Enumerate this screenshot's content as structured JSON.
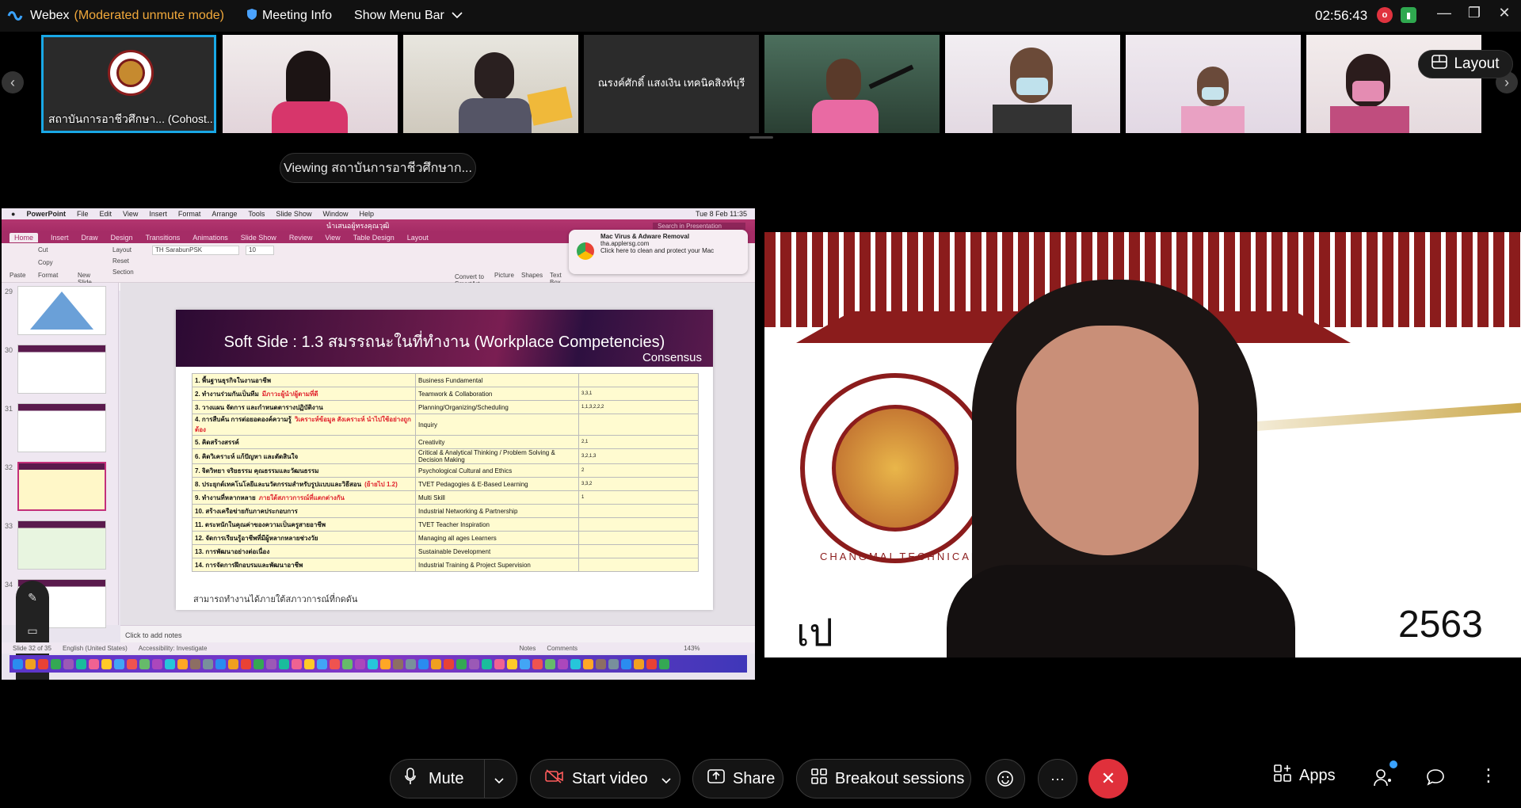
{
  "window": {
    "app_name": "Webex",
    "mode": "(Moderated unmute mode)",
    "meeting_info": "Meeting Info",
    "show_menu_bar": "Show Menu Bar",
    "clock": "02:56:43",
    "rec_icon": "record-icon",
    "minimize": "—",
    "restore": "❐",
    "close": "✕"
  },
  "participants": [
    {
      "name": "สถาบันการอาชีวศึกษา... (Cohost...)",
      "kind": "logo",
      "active": true
    },
    {
      "name": "",
      "kind": "video",
      "color": "#e7d9dc"
    },
    {
      "name": "",
      "kind": "video",
      "color": "#d8d4cc"
    },
    {
      "name": "ณรงค์ศักดิ์ แสงเงิน เทคนิคสิงห์บุรี",
      "kind": "text"
    },
    {
      "name": "",
      "kind": "video",
      "color": "#557a66"
    },
    {
      "name": "",
      "kind": "video",
      "color": "#e6dde5"
    },
    {
      "name": "",
      "kind": "video",
      "color": "#e4dcea"
    },
    {
      "name": "",
      "kind": "video",
      "color": "#eae1e4"
    }
  ],
  "layout_button": "Layout",
  "viewing_label": "Viewing สถาบันการอาชีวศึกษาก...",
  "shared_screen": {
    "mac_menu": [
      "PowerPoint",
      "File",
      "Edit",
      "View",
      "Insert",
      "Format",
      "Arrange",
      "Tools",
      "Slide Show",
      "Window",
      "Help"
    ],
    "mac_time": "Tue 8 Feb  11:35",
    "doc_title": "นำเสนอผู้ทรงคุณวุฒิ",
    "ribbon_tabs": [
      "Home",
      "Insert",
      "Draw",
      "Design",
      "Transitions",
      "Animations",
      "Slide Show",
      "Review",
      "View",
      "Table Design",
      "Layout"
    ],
    "font_name": "TH SarabunPSK",
    "font_size": "10",
    "ribbon_labels": {
      "paste": "Paste",
      "cut": "Cut",
      "copy": "Copy",
      "format": "Format",
      "new_slide": "New Slide",
      "layout": "Layout",
      "reset": "Reset",
      "section": "Section",
      "picture": "Picture",
      "shapes": "Shapes",
      "text_box": "Text Box",
      "convert": "Convert to SmartArt"
    },
    "popup": {
      "title": "Mac Virus & Adware Removal",
      "domain": "tha.applersg.com",
      "body": "Click here to clean and protect your Mac"
    },
    "search_placeholder": "Search in Presentation",
    "slide_numbers": [
      "29",
      "30",
      "31",
      "32",
      "33",
      "34"
    ],
    "slide": {
      "title": "Soft Side : 1.3 สมรรถนะในที่ทำงาน (Workplace Competencies)",
      "consensus": "Consensus",
      "rows": [
        {
          "th": "1. พื้นฐานธุรกิจในงานอาชีพ",
          "red": "",
          "en": "Business Fundamental",
          "score": ""
        },
        {
          "th": "2. ทำงานร่วมกันเป็นทีม",
          "red": "มีภาวะผู้นำ/ผู้ตามที่ดี",
          "en": "Teamwork & Collaboration",
          "score": "3,3,1"
        },
        {
          "th": "3. วางแผน จัดการ และกำหนดตารางปฏิบัติงาน",
          "red": "",
          "en": "Planning/Organizing/Scheduling",
          "score": "1,1,3,2,2,2"
        },
        {
          "th": "4. การสืบค้น การต่อยอดองค์ความรู้",
          "red": "วิเคราะห์ข้อมูล สังเคราะห์ นำไปใช้อย่างถูกต้อง",
          "en": "Inquiry",
          "score": ""
        },
        {
          "th": "5. คิดสร้างสรรค์",
          "red": "",
          "en": "Creativity",
          "score": "2,1"
        },
        {
          "th": "6. คิดวิเคราะห์ แก้ปัญหา และตัดสินใจ",
          "red": "",
          "en": "Critical & Analytical Thinking / Problem Solving & Decision Making",
          "score": "3,2,1,3"
        },
        {
          "th": "7. จิตวิทยา จริยธรรม คุณธรรมและวัฒนธรรม",
          "red": "",
          "en": "Psychological Cultural and Ethics",
          "score": "2"
        },
        {
          "th": "8. ประยุกต์เทคโนโลยีและนวัตกรรมสำหรับรูปแบบและวิธีสอน",
          "red": "(ย้ายไป 1.2)",
          "en": "TVET Pedagogies & E-Based Learning",
          "score": "3,3,2"
        },
        {
          "th": "9. ทำงานที่หลากหลาย",
          "red": "ภายใต้สภาวการณ์ที่แตกต่างกัน",
          "en": "Multi Skill",
          "score": "1"
        },
        {
          "th": "10. สร้างเครือข่ายกับภาคประกอบการ",
          "red": "",
          "en": "Industrial Networking &  Partnership",
          "score": ""
        },
        {
          "th": "11. ตระหนักในคุณค่าของความเป็นครูสายอาชีพ",
          "red": "",
          "en": "TVET Teacher Inspiration",
          "score": ""
        },
        {
          "th": "12. จัดการเรียนรู้อาชีพที่มีผู้หลากหลายช่วงวัย",
          "red": "",
          "en": "Managing all ages Learners",
          "score": ""
        },
        {
          "th": "13. การพัฒนาอย่างต่อเนื่อง",
          "red": "",
          "en": "Sustainable Development",
          "score": ""
        },
        {
          "th": "14. การจัดการฝึกอบรมและพัฒนาอาชีพ",
          "red": "",
          "en": "Industrial Training & Project Supervision",
          "score": ""
        }
      ],
      "footer": "สามารถทำงานได้ภายใต้สภาวการณ์ที่กดดัน"
    },
    "notes_placeholder": "Click to add notes",
    "status": [
      "Slide 32 of 35",
      "English (United States)",
      "Accessibility: Investigate",
      "Notes",
      "Comments",
      "143%"
    ]
  },
  "speaker": {
    "banner_text": "เป",
    "banner_year": "2563",
    "seal_text": "CHANGMAI TECHNICAL COLLEGE"
  },
  "controls": {
    "mute": "Mute",
    "start_video": "Start video",
    "share": "Share",
    "breakout": "Breakout sessions",
    "apps": "Apps"
  }
}
